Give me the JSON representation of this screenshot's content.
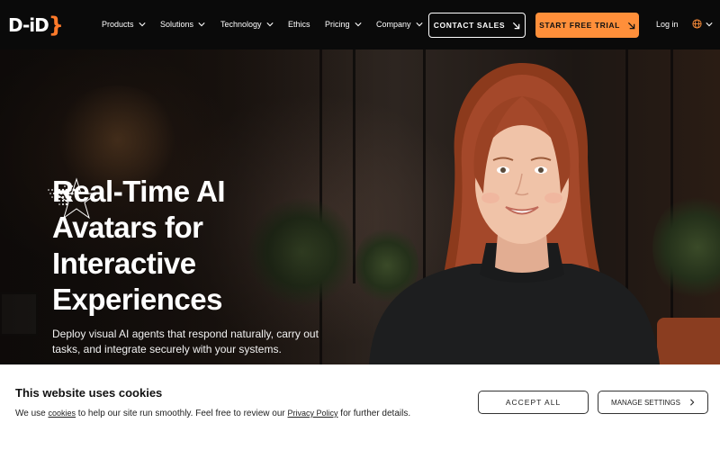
{
  "brand": {
    "logo_text": "D-iD",
    "logo_brace": "}",
    "accent_color": "#ff8f3a"
  },
  "nav": {
    "items": [
      {
        "label": "Products",
        "has_dropdown": true
      },
      {
        "label": "Solutions",
        "has_dropdown": true
      },
      {
        "label": "Technology",
        "has_dropdown": true
      },
      {
        "label": "Ethics",
        "has_dropdown": false
      },
      {
        "label": "Pricing",
        "has_dropdown": true
      },
      {
        "label": "Company",
        "has_dropdown": true
      }
    ],
    "contact_sales": "CONTACT SALES",
    "start_trial": "START FREE TRIAL",
    "login": "Log in",
    "language_icon": "globe-icon"
  },
  "hero": {
    "title_lines": [
      "Real-Time AI",
      "Avatars for",
      "Interactive",
      "Experiences"
    ],
    "subtitle": "Deploy visual AI agents that respond naturally, carry out tasks, and integrate securely with your systems."
  },
  "cookie": {
    "title": "This website uses cookies",
    "text_before_cookies": "We use ",
    "cookies_link": "cookies",
    "text_middle": " to help our site run smoothly. Feel free to review our ",
    "privacy_link": "Privacy Policy",
    "text_after": " for further details.",
    "accept_label": "ACCEPT ALL",
    "manage_label": "MANAGE SETTINGS"
  }
}
